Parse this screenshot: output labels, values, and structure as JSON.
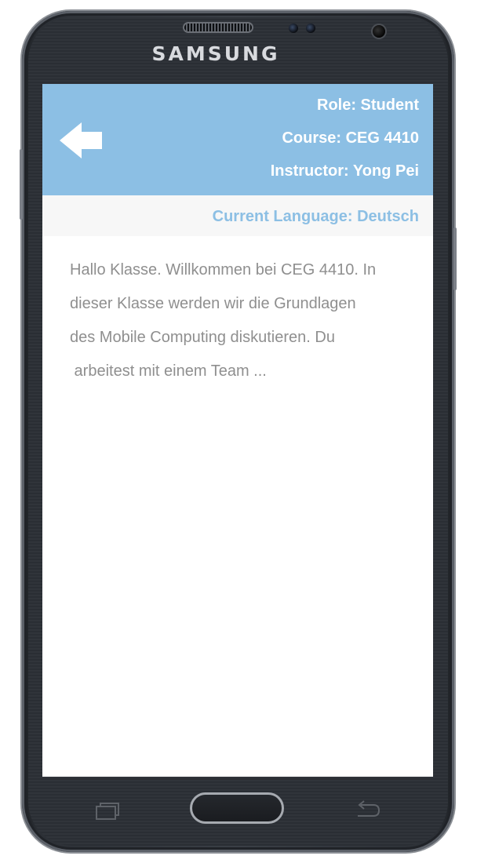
{
  "device": {
    "brand": "SAMSUNG"
  },
  "header": {
    "back_icon": "back-arrow-icon",
    "role": "Role: Student",
    "course": "Course: CEG 4410",
    "instructor": "Instructor: Yong Pei",
    "background_color": "#8cbfe4"
  },
  "language_bar": {
    "label": "Current Language: Deutsch",
    "color": "#8cbfe4"
  },
  "content": {
    "lines": [
      "Hallo Klasse. Willkommen bei CEG 4410. In",
      "dieser Klasse werden wir die Grundlagen",
      "des Mobile Computing diskutieren. Du",
      " arbeitest mit einem Team ..."
    ]
  },
  "hardware_keys": {
    "recents_icon": "recents-icon",
    "home_icon": "home-button",
    "back_icon": "back-key-icon"
  }
}
